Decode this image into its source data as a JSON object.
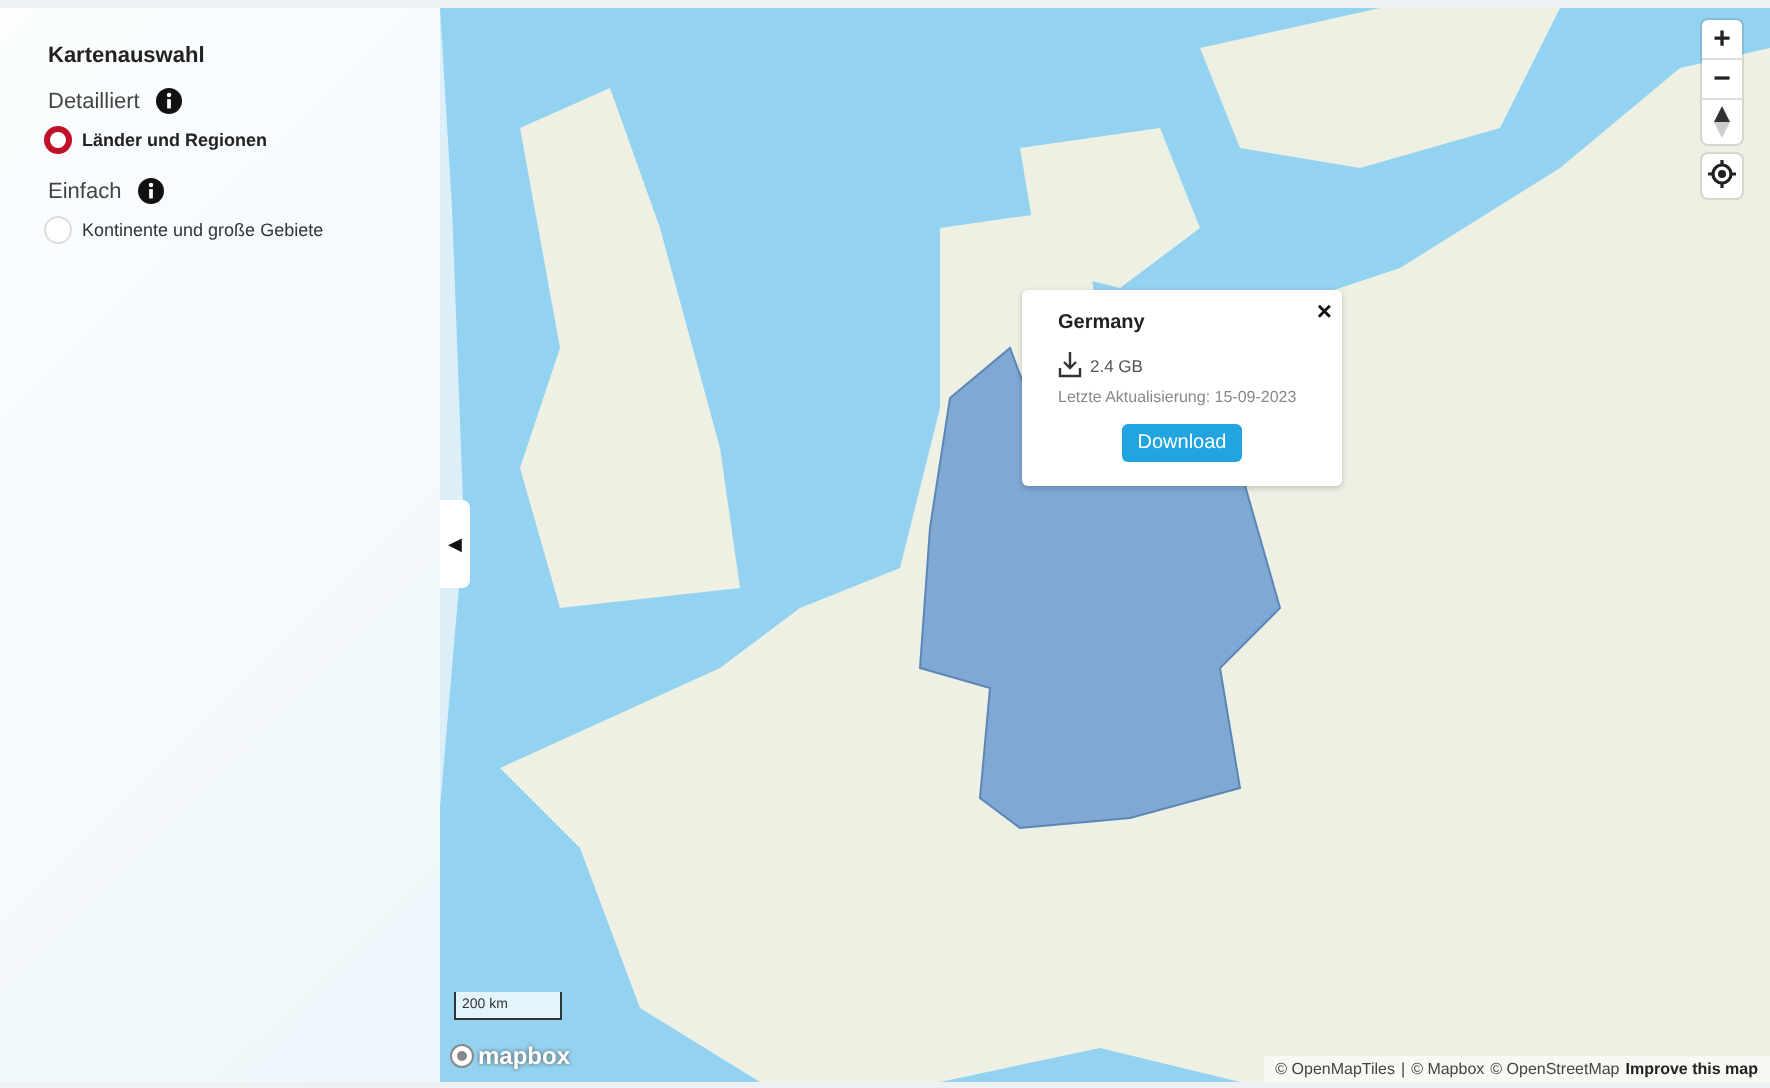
{
  "sidebar": {
    "title": "Kartenauswahl",
    "groups": [
      {
        "label": "Detailliert",
        "options": [
          {
            "label": "Länder und Regionen",
            "selected": true
          }
        ]
      },
      {
        "label": "Einfach",
        "options": [
          {
            "label": "Kontinente und große Gebiete",
            "selected": false
          }
        ]
      }
    ],
    "collapse_toggle": "◀"
  },
  "map": {
    "zoom_in": "+",
    "zoom_out": "−",
    "scale": "200 km",
    "logo": "mapbox",
    "attribution": [
      "© OpenMapTiles",
      "|",
      "© Mapbox",
      "© OpenStreetMap"
    ],
    "improve_link": "Improve this map",
    "popup": {
      "title": "Germany",
      "close": "×",
      "size": "2.4 GB",
      "updated": "Letzte Aktualisierung: 15-09-2023",
      "button": "Download"
    }
  }
}
